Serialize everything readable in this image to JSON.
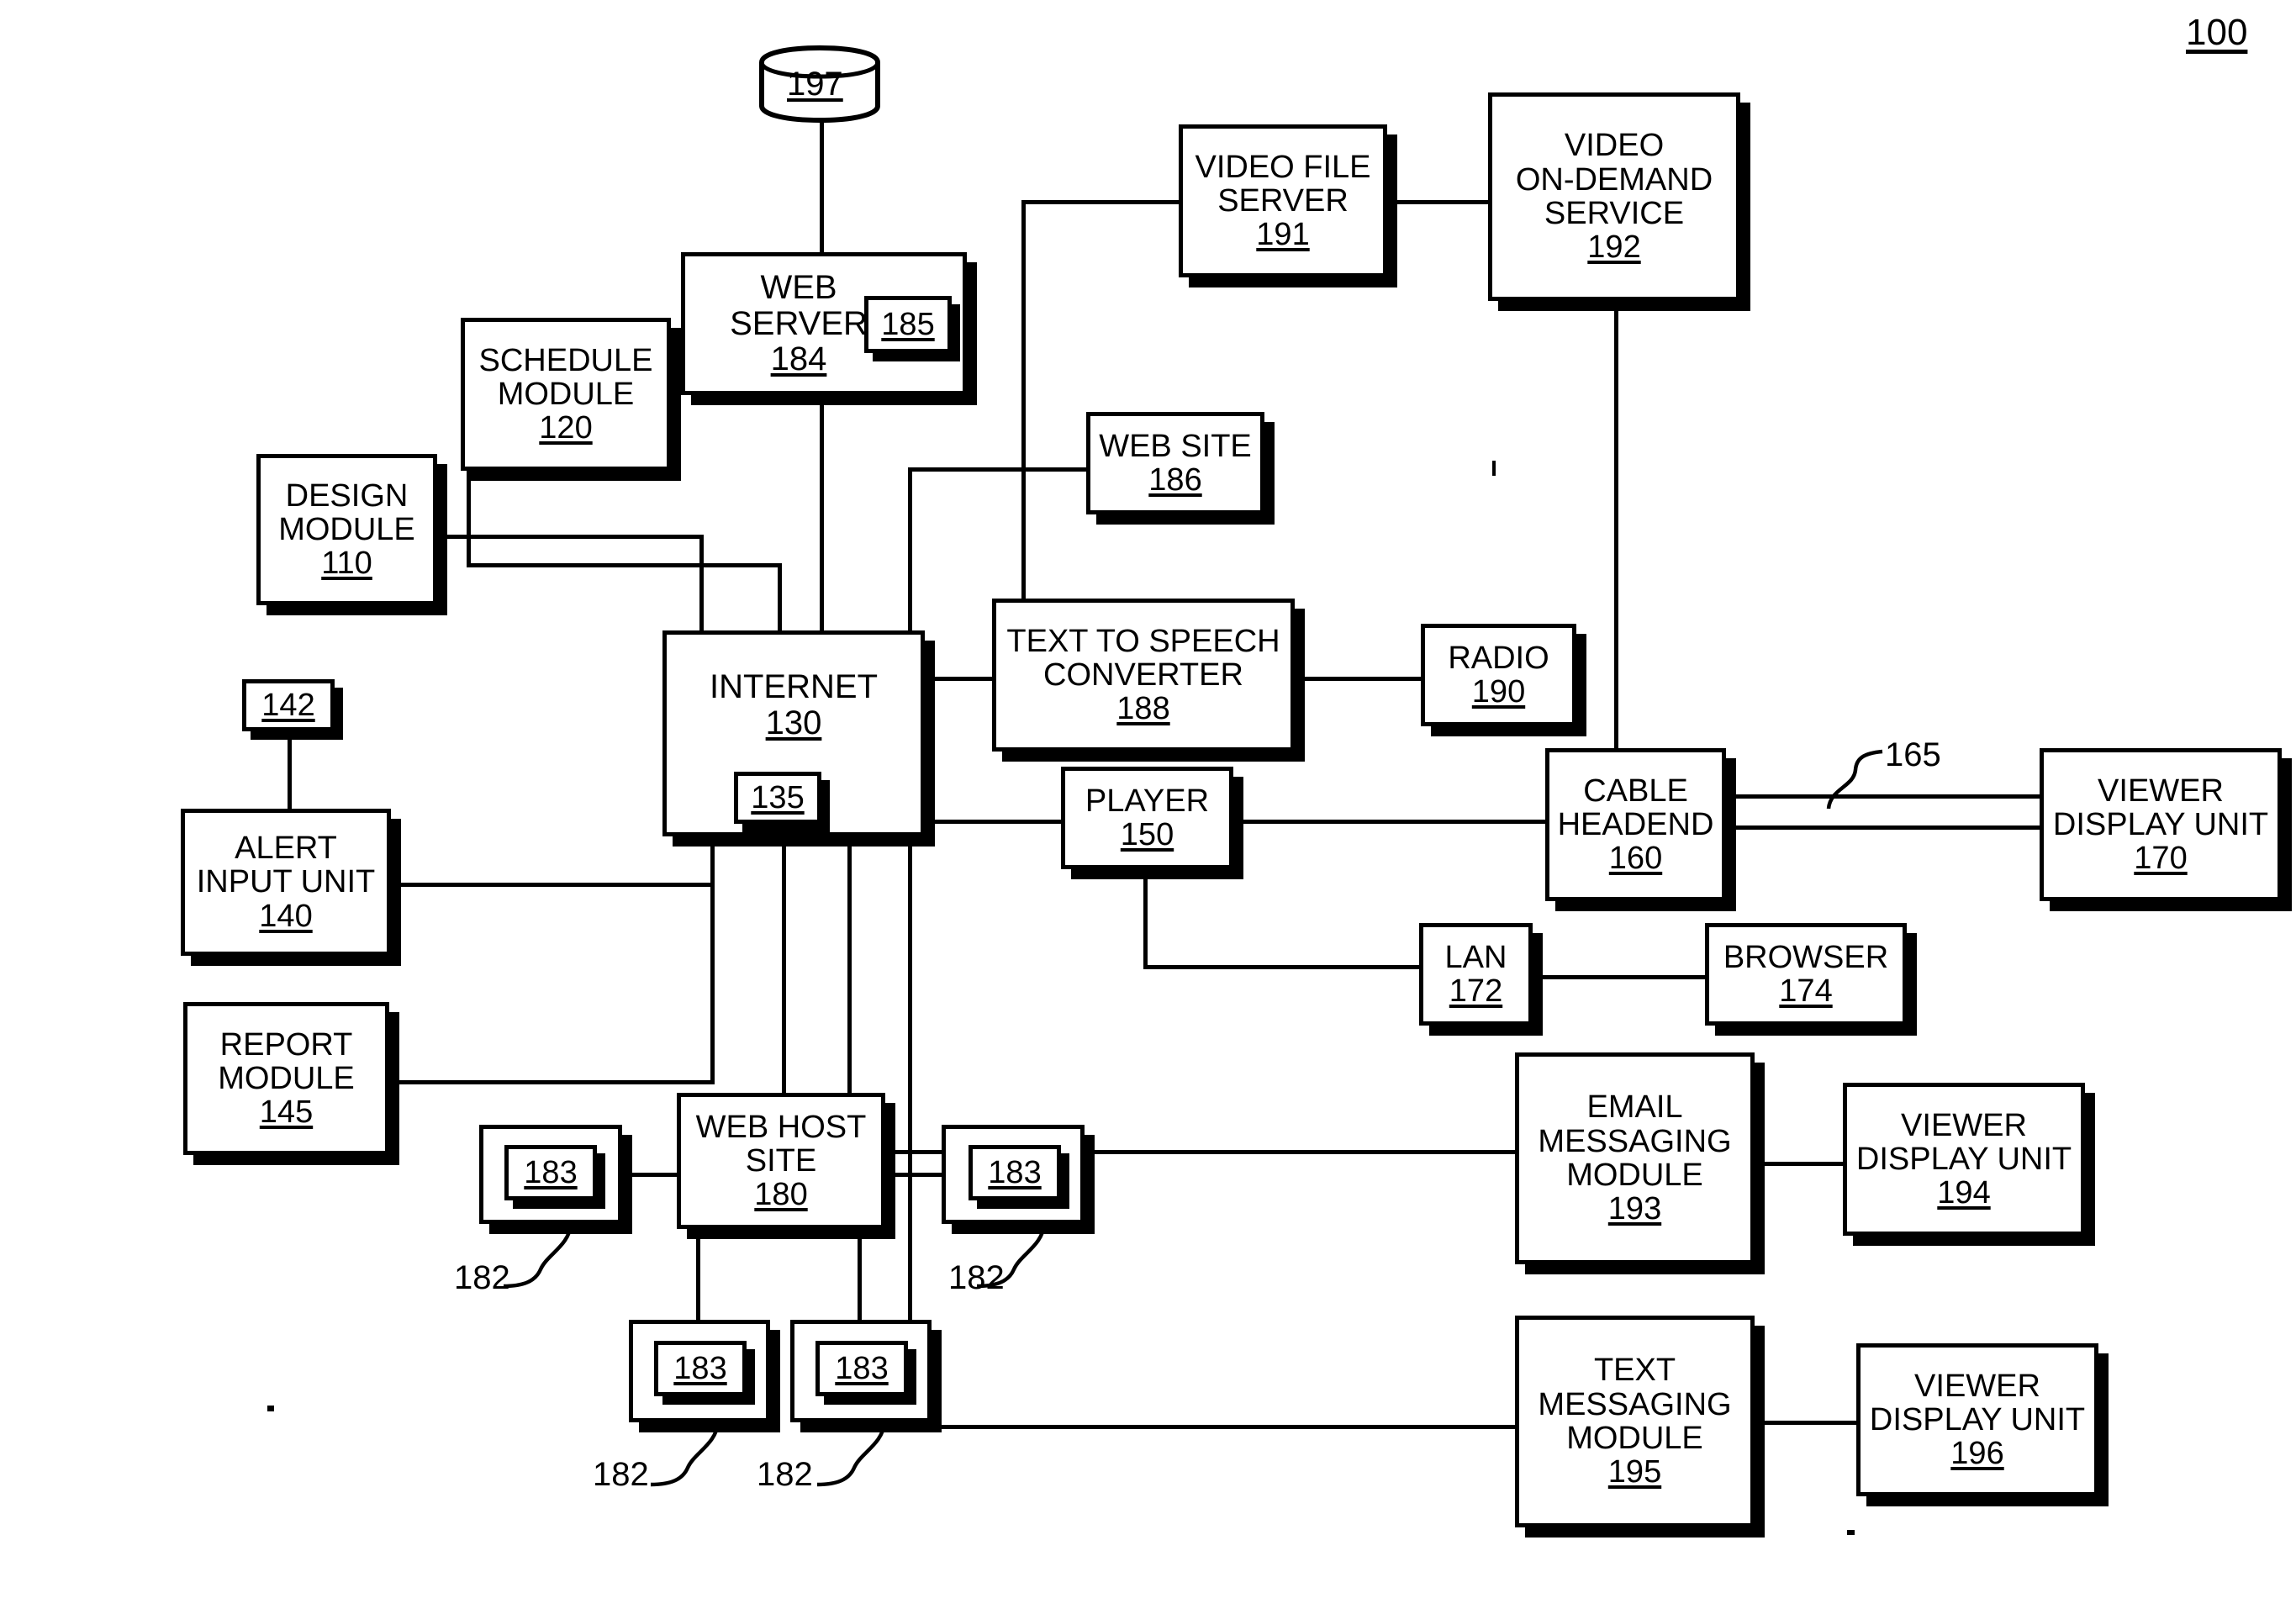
{
  "figure": {
    "number": "100"
  },
  "nodes": {
    "db": {
      "label": "197",
      "name": "database-197"
    },
    "web_server": {
      "line1": "WEB",
      "line2": "SERVER",
      "num": "184",
      "inner": "185"
    },
    "schedule_module": {
      "line1": "SCHEDULE",
      "line2": "MODULE",
      "num": "120"
    },
    "design_module": {
      "line1": "DESIGN",
      "line2": "MODULE",
      "num": "110"
    },
    "video_file_server": {
      "line1": "VIDEO FILE",
      "line2": "SERVER",
      "num": "191"
    },
    "video_on_demand": {
      "line1": "VIDEO",
      "line2": "ON-DEMAND",
      "line3": "SERVICE",
      "num": "192"
    },
    "web_site": {
      "line1": "WEB SITE",
      "num": "186"
    },
    "internet": {
      "line1": "INTERNET",
      "num": "130",
      "inner": "135"
    },
    "tts": {
      "line1": "TEXT TO SPEECH",
      "line2": "CONVERTER",
      "num": "188"
    },
    "radio": {
      "line1": "RADIO",
      "num": "190"
    },
    "player": {
      "line1": "PLAYER",
      "num": "150"
    },
    "cable_headend": {
      "line1": "CABLE",
      "line2": "HEADEND",
      "num": "160"
    },
    "viewer_display_170": {
      "line1": "VIEWER",
      "line2": "DISPLAY UNIT",
      "num": "170"
    },
    "alert_input": {
      "line1": "ALERT",
      "line2": "INPUT UNIT",
      "num": "140",
      "plaque": "142"
    },
    "report_module": {
      "line1": "REPORT",
      "line2": "MODULE",
      "num": "145"
    },
    "lan": {
      "line1": "LAN",
      "num": "172"
    },
    "browser": {
      "line1": "BROWSER",
      "num": "174"
    },
    "email_messaging": {
      "line1": "EMAIL",
      "line2": "MESSAGING",
      "line3": "MODULE",
      "num": "193"
    },
    "viewer_display_194": {
      "line1": "VIEWER",
      "line2": "DISPLAY UNIT",
      "num": "194"
    },
    "text_messaging": {
      "line1": "TEXT",
      "line2": "MESSAGING",
      "line3": "MODULE",
      "num": "195"
    },
    "viewer_display_196": {
      "line1": "VIEWER",
      "line2": "DISPLAY UNIT",
      "num": "196"
    },
    "web_host_site": {
      "line1": "WEB HOST",
      "line2": "SITE",
      "num": "180"
    }
  },
  "web_host_units": [
    {
      "inner": "183",
      "leader": "182"
    },
    {
      "inner": "183",
      "leader": "182"
    },
    {
      "inner": "183",
      "leader": "182"
    },
    {
      "inner": "183",
      "leader": "182"
    }
  ],
  "callouts": {
    "cable_link": "165"
  }
}
